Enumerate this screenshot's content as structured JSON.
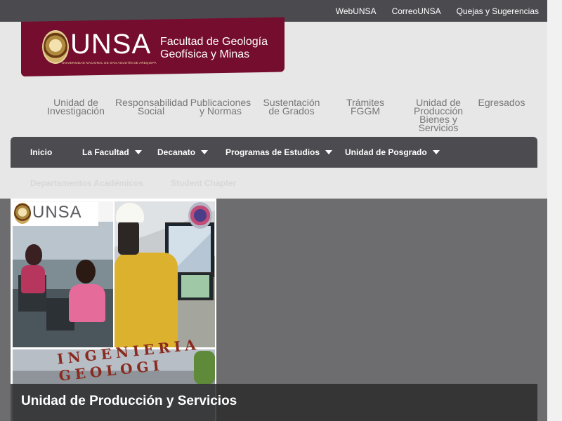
{
  "topbar": {
    "links": [
      "WebUNSA",
      "CorreoUNSA",
      "Quejas y Sugerencias"
    ]
  },
  "brand": {
    "logo_text": "UNSA",
    "logo_subtext": "UNIVERSIDAD NACIONAL DE SAN AGUSTÍN DE AREQUIPA",
    "faculty_line1": "Facultad de Geología",
    "faculty_line2": "Geofísica y Minas"
  },
  "subnav": {
    "items": [
      {
        "line1": "Unidad de",
        "line2": "Investigación",
        "line3": "",
        "line4": ""
      },
      {
        "line1": "Responsabilidad",
        "line2": "Social",
        "line3": "",
        "line4": ""
      },
      {
        "line1": "Publicaciones",
        "line2": "y Normas",
        "line3": "",
        "line4": ""
      },
      {
        "line1": "Sustentación",
        "line2": "de Grados",
        "line3": "",
        "line4": ""
      },
      {
        "line1": "Trámites",
        "line2": "FGGM",
        "line3": "",
        "line4": ""
      },
      {
        "line1": "Unidad de",
        "line2": "Producción",
        "line3": "Bienes y",
        "line4": "Servicios"
      },
      {
        "line1": "Egresados",
        "line2": "",
        "line3": "",
        "line4": ""
      }
    ]
  },
  "mainnav": {
    "items": [
      {
        "label": "Inicio"
      },
      {
        "label": "La Facultad"
      },
      {
        "label": "Decanato"
      },
      {
        "label": "Programas de Estudios"
      },
      {
        "label": "Unidad de Posgrado"
      }
    ]
  },
  "secnav": {
    "items": [
      "Departamentos Académicos",
      "Student Chapter"
    ]
  },
  "tile": {
    "mini_logo_text": "UNSA",
    "sign_text": "INGENIERIA GEOLOGI",
    "caption": "Unidad de Producción y Servicios"
  }
}
